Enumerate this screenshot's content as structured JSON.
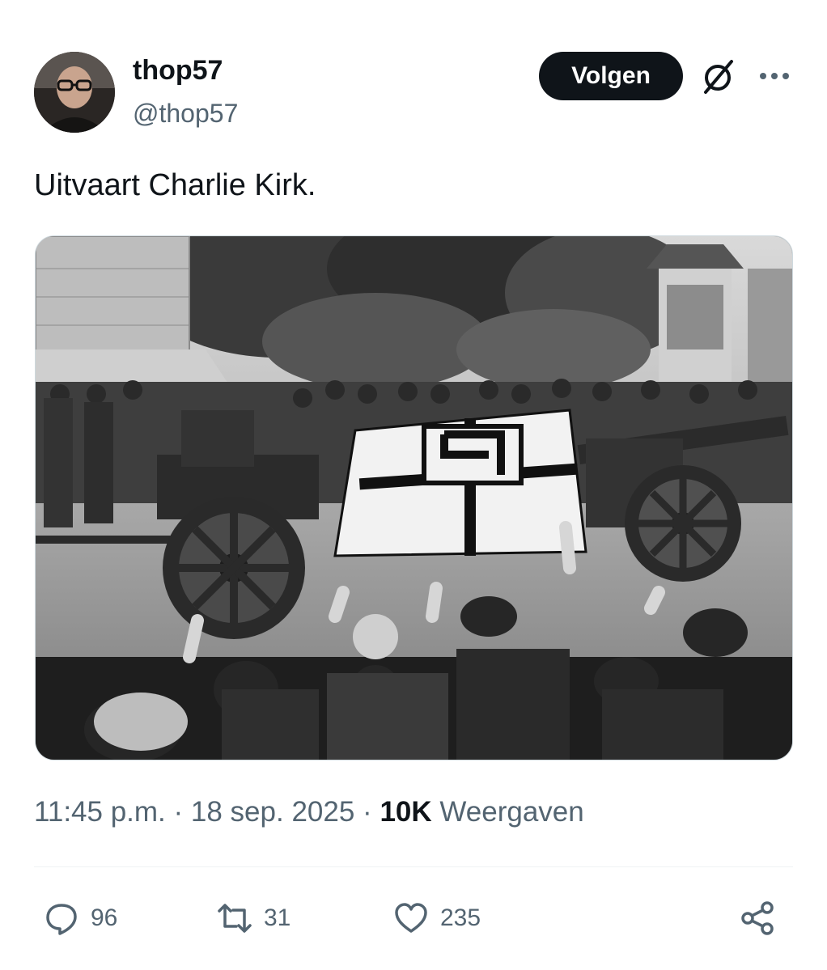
{
  "user": {
    "name": "thop57",
    "handle": "@thop57"
  },
  "follow_label": "Volgen",
  "tweet": {
    "text": "Uitvaart Charlie Kirk."
  },
  "meta": {
    "time": "11:45 p.m.",
    "separator": "·",
    "date": "18 sep. 2025",
    "views_count": "10K",
    "views_label": "Weergaven"
  },
  "stats": {
    "replies": "96",
    "retweets": "31",
    "likes": "235"
  },
  "icons": {
    "grok": "grok-icon",
    "more": "more-icon",
    "reply": "reply-icon",
    "retweet": "retweet-icon",
    "like": "heart-icon",
    "share": "share-icon"
  },
  "colors": {
    "primary_text": "#0f1419",
    "secondary_text": "#536471",
    "button_bg": "#0f1419",
    "divider": "#eff3f4"
  }
}
